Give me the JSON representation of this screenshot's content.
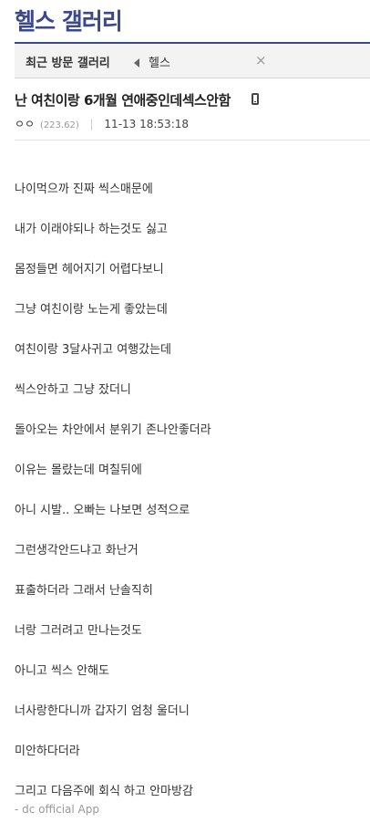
{
  "gallery": {
    "title": "헬스 갤러리"
  },
  "recent_bar": {
    "label": "최근 방문 갤러리",
    "item": "헬스",
    "close_symbol": "×"
  },
  "post": {
    "title": "난 여친이랑 6개월 연애중인데섹스안함",
    "author": "ㅇㅇ",
    "ip": "(223.62)",
    "datetime": "11-13 18:53:18",
    "separator": "|",
    "lines": [
      "나이먹으까 진짜 씩스매문에",
      "내가 이래야되나 하는것도 싫고",
      "몸정들면 헤어지기 어렵다보니",
      "그냥 여친이랑 노는게 좋았는데",
      "여친이랑 3달사귀고 여행갔는데",
      "씩스안하고 그냥 잤더니",
      "돌아오는 차안에서 분위기 존나안좋더라",
      "이유는 몰랐는데 며칠뒤에",
      "아니 시발.. 오빠는 나보면 성적으로",
      "그런생각안드냐고 화난거",
      "표출하더라 그래서 난솔직히",
      "너랑 그러려고 만나는것도",
      "아니고 씩스 안해도",
      "너사랑한다니까 갑자기 엄청 울더니",
      "미안하다더라",
      "그리고 다음주에 회식 하고 안마방감"
    ],
    "app_signature": "- dc official App"
  }
}
